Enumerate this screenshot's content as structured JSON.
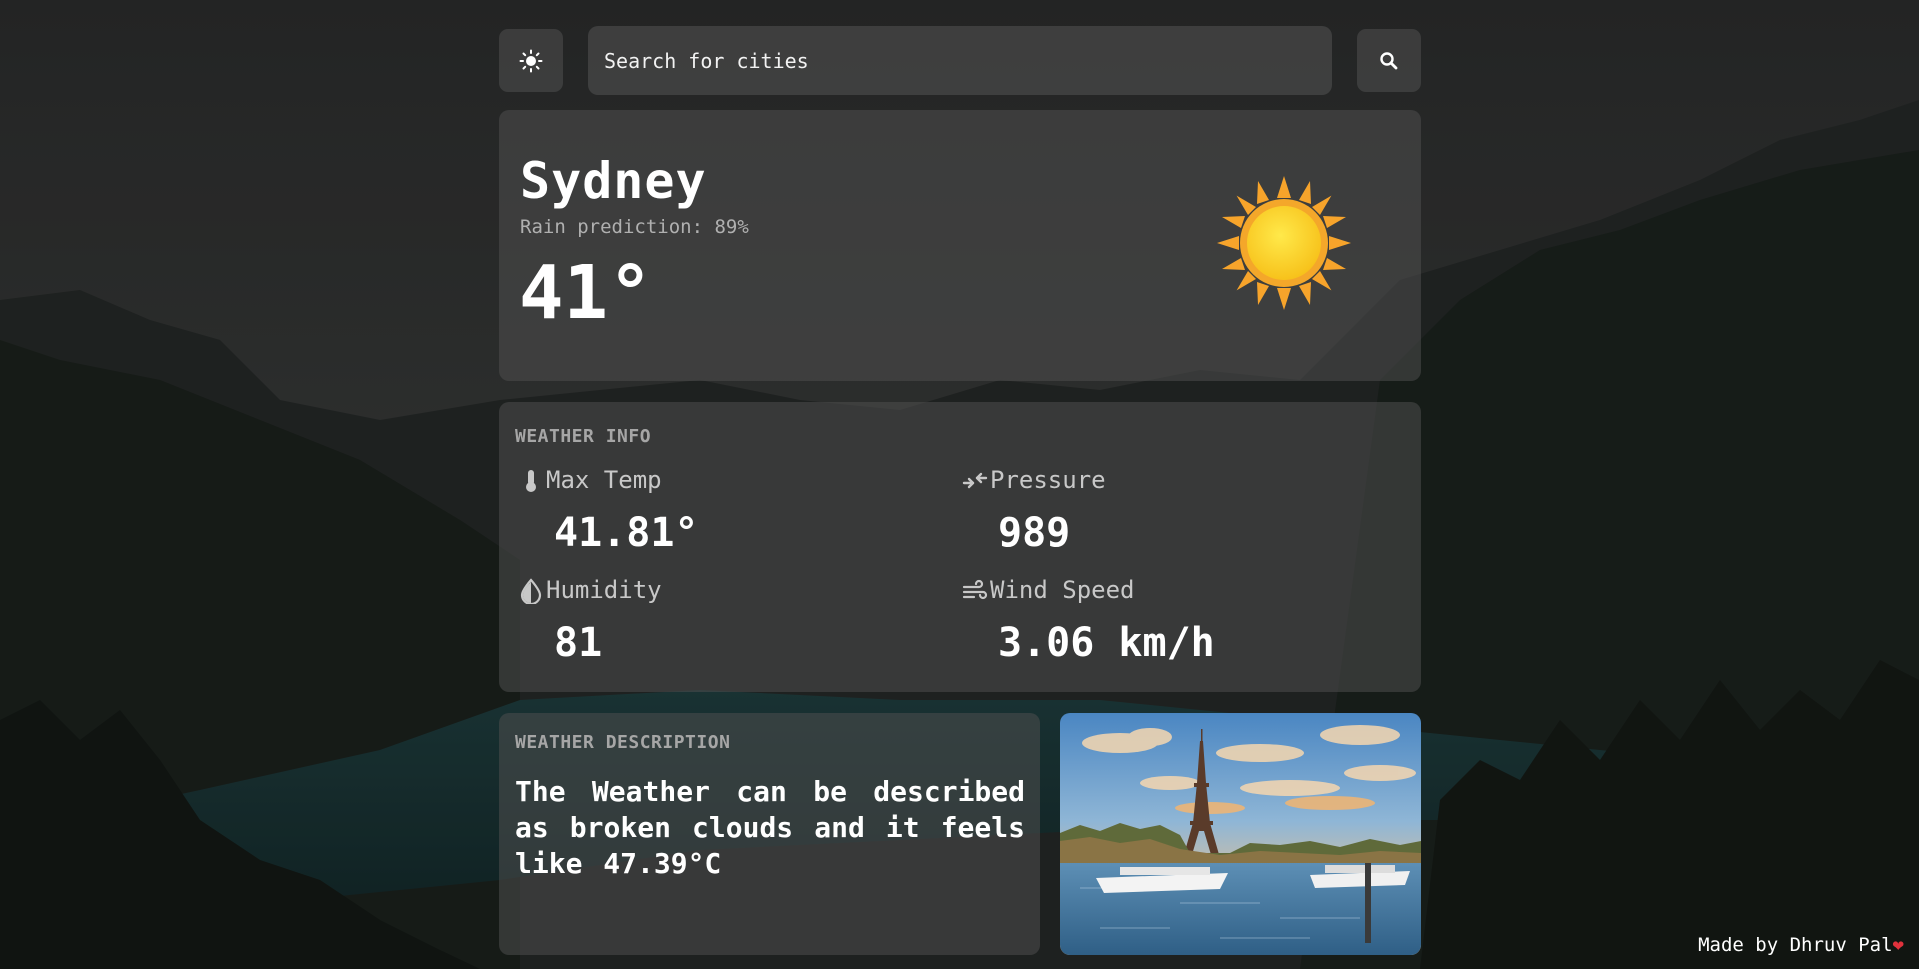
{
  "header": {
    "theme_toggle_icon": "sun-icon",
    "search_placeholder": "Search for cities",
    "search_value": "",
    "search_button_icon": "search-icon"
  },
  "current": {
    "city": "Sydney",
    "rain_prediction": "Rain prediction: 89%",
    "temperature": "41°",
    "weather_icon": "sun-icon"
  },
  "weather_info": {
    "title": "WEATHER INFO",
    "items": [
      {
        "label": "Max Temp",
        "value": "41.81°",
        "icon": "thermometer-icon"
      },
      {
        "label": "Pressure",
        "value": "989",
        "icon": "pressure-arrows-icon"
      },
      {
        "label": "Humidity",
        "value": "81",
        "icon": "droplet-icon"
      },
      {
        "label": "Wind Speed",
        "value": "3.06 km/h",
        "icon": "wind-icon"
      }
    ]
  },
  "weather_description": {
    "title": "WEATHER DESCRIPTION",
    "text": "The Weather can be described as broken clouds and it feels like 47.39°C"
  },
  "city_photo": {
    "icon": "city-photo"
  },
  "footer": {
    "text": "Made by Dhruv Pal",
    "icon": "heart-icon"
  },
  "colors": {
    "card_bg": "#4e4e4e",
    "text_primary": "#ffffff",
    "text_muted": "#a6a6a6",
    "sun": "#f7a42b",
    "heart": "#e0323c"
  }
}
